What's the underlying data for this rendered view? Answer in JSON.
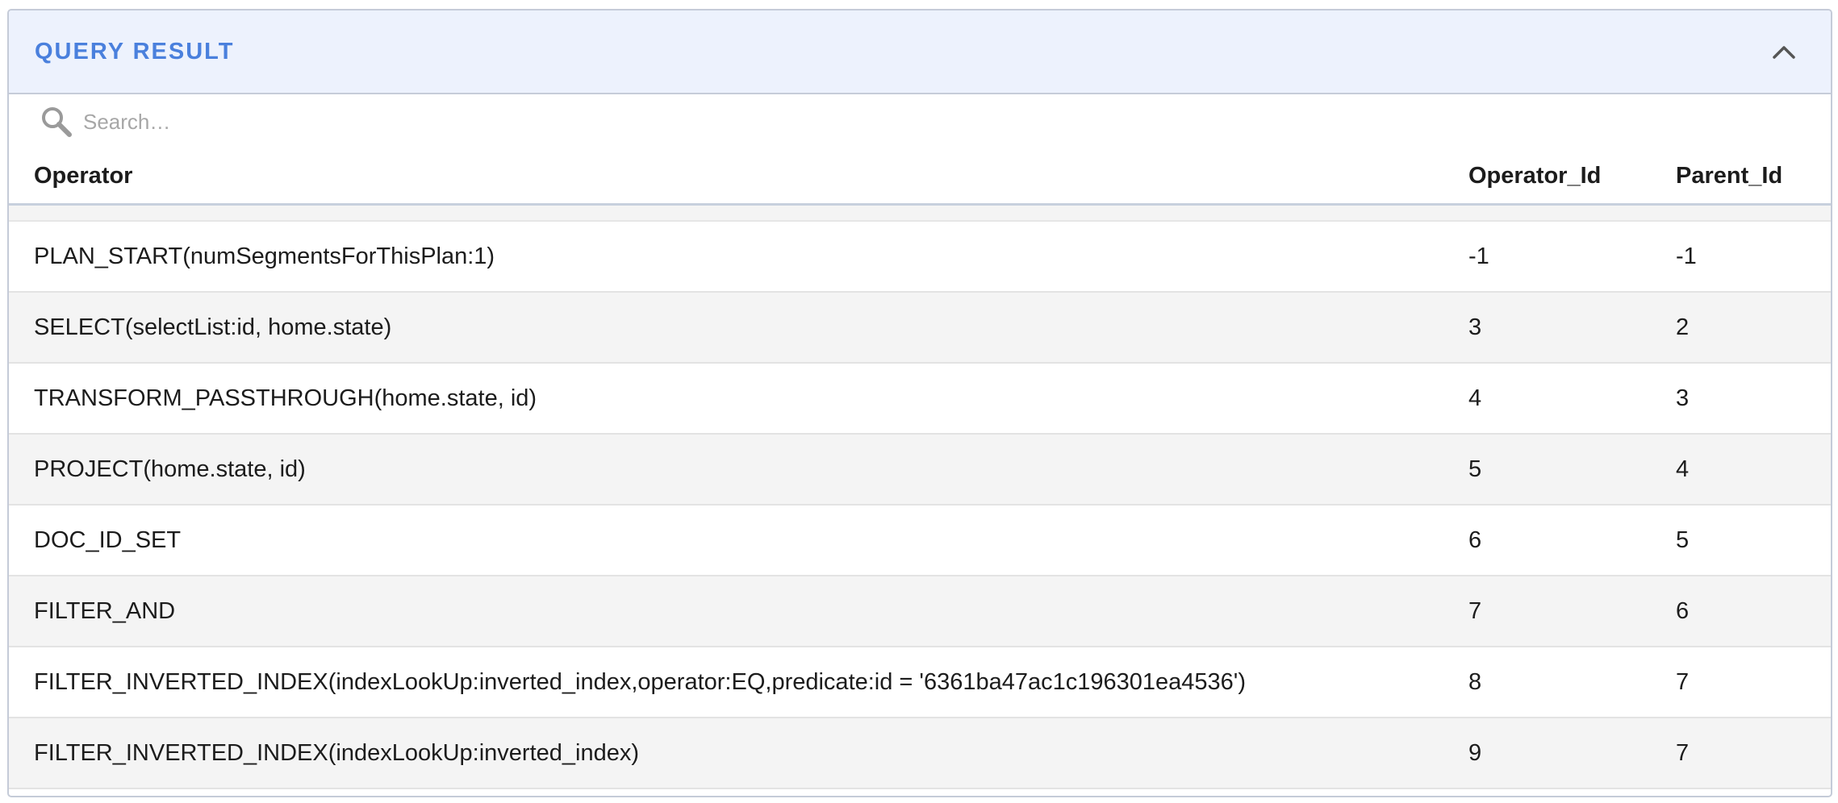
{
  "panel": {
    "title": "QUERY RESULT"
  },
  "search": {
    "placeholder": "Search…",
    "value": ""
  },
  "table": {
    "columns": [
      "Operator",
      "Operator_Id",
      "Parent_Id"
    ],
    "rows": [
      {
        "operator": "PLAN_START(numSegmentsForThisPlan:1)",
        "operator_id": "-1",
        "parent_id": "-1"
      },
      {
        "operator": "SELECT(selectList:id, home.state)",
        "operator_id": "3",
        "parent_id": "2"
      },
      {
        "operator": "TRANSFORM_PASSTHROUGH(home.state, id)",
        "operator_id": "4",
        "parent_id": "3"
      },
      {
        "operator": "PROJECT(home.state, id)",
        "operator_id": "5",
        "parent_id": "4"
      },
      {
        "operator": "DOC_ID_SET",
        "operator_id": "6",
        "parent_id": "5"
      },
      {
        "operator": "FILTER_AND",
        "operator_id": "7",
        "parent_id": "6"
      },
      {
        "operator": "FILTER_INVERTED_INDEX(indexLookUp:inverted_index,operator:EQ,predicate:id = '6361ba47ac1c196301ea4536')",
        "operator_id": "8",
        "parent_id": "7"
      },
      {
        "operator": "FILTER_INVERTED_INDEX(indexLookUp:inverted_index)",
        "operator_id": "9",
        "parent_id": "7"
      }
    ]
  },
  "icons": {
    "collapse": "chevron-up-icon",
    "search": "search-icon"
  },
  "colors": {
    "header_bg": "#edf2fd",
    "title": "#4a80dd",
    "row_alt": "#f4f4f4"
  }
}
